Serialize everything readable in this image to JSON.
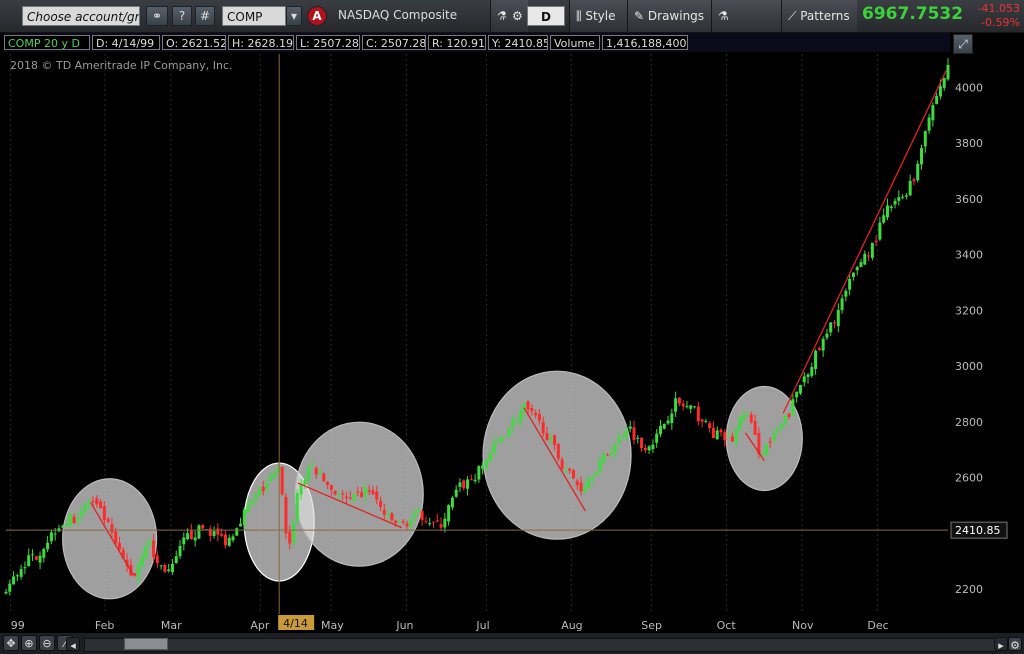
{
  "toolbar": {
    "account_placeholder": "Choose account/gr...",
    "symbol": "COMP",
    "alert_label": "A",
    "symbol_name": "NASDAQ Composite",
    "help_label": "?",
    "hash_label": "#",
    "drawing_set": "D",
    "style_label": "Style",
    "drawings_label": "Drawings",
    "studies_label": "Studies",
    "patterns_label": "Patterns",
    "last_price": "6967.7532",
    "net_change": "-41.053",
    "pct_change": "-0.59%"
  },
  "infobar": {
    "period": "COMP 20 y D",
    "date": "D: 4/14/99",
    "open": "O: 2621.52",
    "high": "H: 2628.19",
    "low": "L: 2507.28",
    "close": "C: 2507.28",
    "range": "R: 120.91",
    "y_value": "Y: 2410.85",
    "volume_label": "Volume",
    "volume_value": "1,416,188,400"
  },
  "copyright": "2018 © TD Ameritrade IP Company, Inc.",
  "chart_data": {
    "type": "candlestick",
    "x_ticks": [
      "99",
      "Feb",
      "Mar",
      "Apr",
      "May",
      "Jun",
      "Jul",
      "Aug",
      "Sep",
      "Oct",
      "Nov",
      "Dec"
    ],
    "y_ticks": [
      2200,
      2400,
      2600,
      2800,
      3000,
      3200,
      3400,
      3600,
      3800,
      4000
    ],
    "ylim": [
      2110,
      4120
    ],
    "cursor_value": "2410.85",
    "cursor_date_label": "4/14",
    "close_path": [
      {
        "t": 0,
        "v": 2190
      },
      {
        "t": 0.018,
        "v": 2290
      },
      {
        "t": 0.035,
        "v": 2330
      },
      {
        "t": 0.055,
        "v": 2430
      },
      {
        "t": 0.075,
        "v": 2460
      },
      {
        "t": 0.09,
        "v": 2520
      },
      {
        "t": 0.105,
        "v": 2450
      },
      {
        "t": 0.12,
        "v": 2330
      },
      {
        "t": 0.135,
        "v": 2240
      },
      {
        "t": 0.15,
        "v": 2380
      },
      {
        "t": 0.16,
        "v": 2290
      },
      {
        "t": 0.175,
        "v": 2260
      },
      {
        "t": 0.19,
        "v": 2380
      },
      {
        "t": 0.21,
        "v": 2420
      },
      {
        "t": 0.235,
        "v": 2370
      },
      {
        "t": 0.25,
        "v": 2460
      },
      {
        "t": 0.265,
        "v": 2530
      },
      {
        "t": 0.28,
        "v": 2590
      },
      {
        "t": 0.29,
        "v": 2620
      },
      {
        "t": 0.3,
        "v": 2330
      },
      {
        "t": 0.31,
        "v": 2560
      },
      {
        "t": 0.325,
        "v": 2640
      },
      {
        "t": 0.345,
        "v": 2560
      },
      {
        "t": 0.365,
        "v": 2510
      },
      {
        "t": 0.385,
        "v": 2560
      },
      {
        "t": 0.405,
        "v": 2450
      },
      {
        "t": 0.42,
        "v": 2430
      },
      {
        "t": 0.44,
        "v": 2470
      },
      {
        "t": 0.46,
        "v": 2420
      },
      {
        "t": 0.48,
        "v": 2560
      },
      {
        "t": 0.5,
        "v": 2610
      },
      {
        "t": 0.52,
        "v": 2720
      },
      {
        "t": 0.55,
        "v": 2850
      },
      {
        "t": 0.57,
        "v": 2780
      },
      {
        "t": 0.59,
        "v": 2650
      },
      {
        "t": 0.61,
        "v": 2560
      },
      {
        "t": 0.625,
        "v": 2630
      },
      {
        "t": 0.645,
        "v": 2710
      },
      {
        "t": 0.66,
        "v": 2790
      },
      {
        "t": 0.675,
        "v": 2710
      },
      {
        "t": 0.69,
        "v": 2740
      },
      {
        "t": 0.71,
        "v": 2870
      },
      {
        "t": 0.73,
        "v": 2840
      },
      {
        "t": 0.75,
        "v": 2760
      },
      {
        "t": 0.77,
        "v": 2730
      },
      {
        "t": 0.785,
        "v": 2850
      },
      {
        "t": 0.8,
        "v": 2690
      },
      {
        "t": 0.815,
        "v": 2740
      },
      {
        "t": 0.83,
        "v": 2820
      },
      {
        "t": 0.845,
        "v": 2950
      },
      {
        "t": 0.87,
        "v": 3100
      },
      {
        "t": 0.89,
        "v": 3250
      },
      {
        "t": 0.905,
        "v": 3370
      },
      {
        "t": 0.92,
        "v": 3430
      },
      {
        "t": 0.935,
        "v": 3560
      },
      {
        "t": 0.95,
        "v": 3600
      },
      {
        "t": 0.965,
        "v": 3680
      },
      {
        "t": 0.975,
        "v": 3850
      },
      {
        "t": 0.99,
        "v": 3990
      },
      {
        "t": 1.0,
        "v": 4070
      }
    ]
  }
}
